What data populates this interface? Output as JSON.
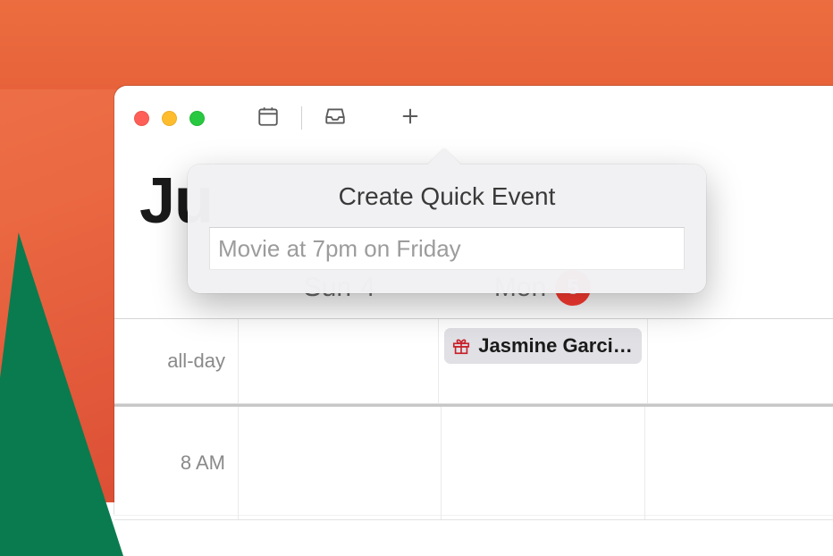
{
  "month_title": "Ju",
  "toolbar": {
    "calendar_icon": "calendar-icon",
    "inbox_icon": "inbox-icon",
    "plus_icon": "plus-icon"
  },
  "popover": {
    "title": "Create Quick Event",
    "placeholder": "Movie at 7pm on Friday",
    "value": ""
  },
  "day_headers": {
    "sun_label": "Sun",
    "sun_num": "4",
    "mon_label": "Mon",
    "mon_num": "5"
  },
  "rows": {
    "allday_label": "all-day",
    "time_0": "8 AM"
  },
  "events": {
    "allday_mon": "Jasmine Garci…"
  },
  "colors": {
    "accent_red": "#ff3b30"
  }
}
